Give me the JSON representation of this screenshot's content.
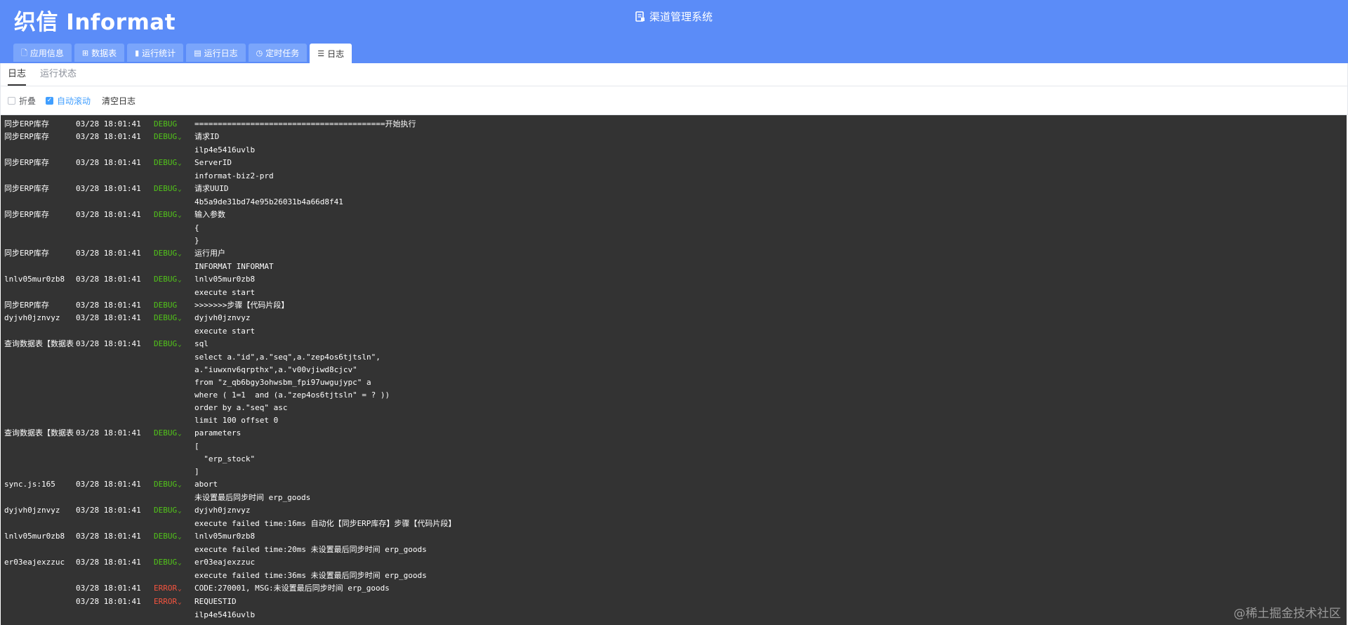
{
  "header": {
    "logo": "织信 Informat",
    "app_title": "渠道管理系统",
    "tabs": [
      {
        "label": "应用信息",
        "icon": "document-icon",
        "glyph": "🗋"
      },
      {
        "label": "数据表",
        "icon": "table-icon",
        "glyph": "⊞"
      },
      {
        "label": "运行统计",
        "icon": "bar-chart-icon",
        "glyph": "▮"
      },
      {
        "label": "运行日志",
        "icon": "log-file-icon",
        "glyph": "▤"
      },
      {
        "label": "定时任务",
        "icon": "clock-icon",
        "glyph": "◷"
      },
      {
        "label": "日志",
        "icon": "list-icon",
        "glyph": "☰"
      }
    ]
  },
  "subtabs": [
    "日志",
    "运行状态"
  ],
  "toolbar": {
    "fold_label": "折叠",
    "autoscroll_label": "自动滚动",
    "clear_label": "清空日志",
    "check_glyph": "✓"
  },
  "chevron": "⌄",
  "logs": [
    {
      "src": "同步ERP库存",
      "time": "03/28 18:01:41",
      "level": "DEBUG",
      "expandable": false,
      "msg": "=========================================开始执行"
    },
    {
      "src": "同步ERP库存",
      "time": "03/28 18:01:41",
      "level": "DEBUG",
      "expandable": true,
      "msg": "请求ID"
    },
    {
      "src": "",
      "time": "",
      "level": "",
      "expandable": false,
      "msg": "ilp4e5416uvlb"
    },
    {
      "src": "同步ERP库存",
      "time": "03/28 18:01:41",
      "level": "DEBUG",
      "expandable": true,
      "msg": "ServerID"
    },
    {
      "src": "",
      "time": "",
      "level": "",
      "expandable": false,
      "msg": "informat-biz2-prd"
    },
    {
      "src": "同步ERP库存",
      "time": "03/28 18:01:41",
      "level": "DEBUG",
      "expandable": true,
      "msg": "请求UUID"
    },
    {
      "src": "",
      "time": "",
      "level": "",
      "expandable": false,
      "msg": "4b5a9de31bd74e95b26031b4a66d8f41"
    },
    {
      "src": "同步ERP库存",
      "time": "03/28 18:01:41",
      "level": "DEBUG",
      "expandable": true,
      "msg": "输入参数"
    },
    {
      "src": "",
      "time": "",
      "level": "",
      "expandable": false,
      "msg": "{"
    },
    {
      "src": "",
      "time": "",
      "level": "",
      "expandable": false,
      "msg": "}"
    },
    {
      "src": "同步ERP库存",
      "time": "03/28 18:01:41",
      "level": "DEBUG",
      "expandable": true,
      "msg": "运行用户"
    },
    {
      "src": "",
      "time": "",
      "level": "",
      "expandable": false,
      "msg": "INFORMAT INFORMAT"
    },
    {
      "src": "lnlv05mur0zb8",
      "time": "03/28 18:01:41",
      "level": "DEBUG",
      "expandable": true,
      "msg": "lnlv05mur0zb8"
    },
    {
      "src": "",
      "time": "",
      "level": "",
      "expandable": false,
      "msg": "execute start"
    },
    {
      "src": "同步ERP库存",
      "time": "03/28 18:01:41",
      "level": "DEBUG",
      "expandable": false,
      "msg": ">>>>>>>步骤【代码片段】"
    },
    {
      "src": "dyjvh0jznvyz",
      "time": "03/28 18:01:41",
      "level": "DEBUG",
      "expandable": true,
      "msg": "dyjvh0jznvyz"
    },
    {
      "src": "",
      "time": "",
      "level": "",
      "expandable": false,
      "msg": "execute start"
    },
    {
      "src": "查询数据表【数据表",
      "time": "03/28 18:01:41",
      "level": "DEBUG",
      "expandable": true,
      "msg": "sql"
    },
    {
      "src": "",
      "time": "",
      "level": "",
      "expandable": false,
      "msg": ""
    },
    {
      "src": "",
      "time": "",
      "level": "",
      "expandable": false,
      "msg": "select a.\"id\",a.\"seq\",a.\"zep4os6tjtsln\","
    },
    {
      "src": "",
      "time": "",
      "level": "",
      "expandable": false,
      "msg": "a.\"iuwxnv6qrpthx\",a.\"v00vjiwd8cjcv\""
    },
    {
      "src": "",
      "time": "",
      "level": "",
      "expandable": false,
      "msg": "from \"z_qb6bgy3ohwsbm_fpi97uwgujypc\" a"
    },
    {
      "src": "",
      "time": "",
      "level": "",
      "expandable": false,
      "msg": "where ( 1=1  and (a.\"zep4os6tjtsln\" = ? ))"
    },
    {
      "src": "",
      "time": "",
      "level": "",
      "expandable": false,
      "msg": "order by a.\"seq\" asc"
    },
    {
      "src": "",
      "time": "",
      "level": "",
      "expandable": false,
      "msg": "limit 100 offset 0"
    },
    {
      "src": "查询数据表【数据表",
      "time": "03/28 18:01:41",
      "level": "DEBUG",
      "expandable": true,
      "msg": "parameters"
    },
    {
      "src": "",
      "time": "",
      "level": "",
      "expandable": false,
      "msg": "["
    },
    {
      "src": "",
      "time": "",
      "level": "",
      "expandable": false,
      "msg": "  \"erp_stock\""
    },
    {
      "src": "",
      "time": "",
      "level": "",
      "expandable": false,
      "msg": "]"
    },
    {
      "src": "sync.js:165",
      "time": "03/28 18:01:41",
      "level": "DEBUG",
      "expandable": true,
      "msg": "abort"
    },
    {
      "src": "",
      "time": "",
      "level": "",
      "expandable": false,
      "msg": "未设置最后同步时间 erp_goods"
    },
    {
      "src": "dyjvh0jznvyz",
      "time": "03/28 18:01:41",
      "level": "DEBUG",
      "expandable": true,
      "msg": "dyjvh0jznvyz"
    },
    {
      "src": "",
      "time": "",
      "level": "",
      "expandable": false,
      "msg": "execute failed time:16ms 自动化【同步ERP库存】步骤【代码片段】"
    },
    {
      "src": "lnlv05mur0zb8",
      "time": "03/28 18:01:41",
      "level": "DEBUG",
      "expandable": true,
      "msg": "lnlv05mur0zb8"
    },
    {
      "src": "",
      "time": "",
      "level": "",
      "expandable": false,
      "msg": "execute failed time:20ms 未设置最后同步时间 erp_goods"
    },
    {
      "src": "er03eajexzzuc",
      "time": "03/28 18:01:41",
      "level": "DEBUG",
      "expandable": true,
      "msg": "er03eajexzzuc"
    },
    {
      "src": "",
      "time": "",
      "level": "",
      "expandable": false,
      "msg": "execute failed time:36ms 未设置最后同步时间 erp_goods"
    },
    {
      "src": "",
      "time": "03/28 18:01:41",
      "level": "ERROR",
      "expandable": true,
      "msg": "CODE:270001, MSG:未设置最后同步时间 erp_goods"
    },
    {
      "src": "",
      "time": "03/28 18:01:41",
      "level": "ERROR",
      "expandable": true,
      "msg": "REQUESTID"
    },
    {
      "src": "",
      "time": "",
      "level": "",
      "expandable": false,
      "msg": "ilp4e5416uvlb"
    }
  ],
  "watermark": "@稀土掘金技术社区"
}
